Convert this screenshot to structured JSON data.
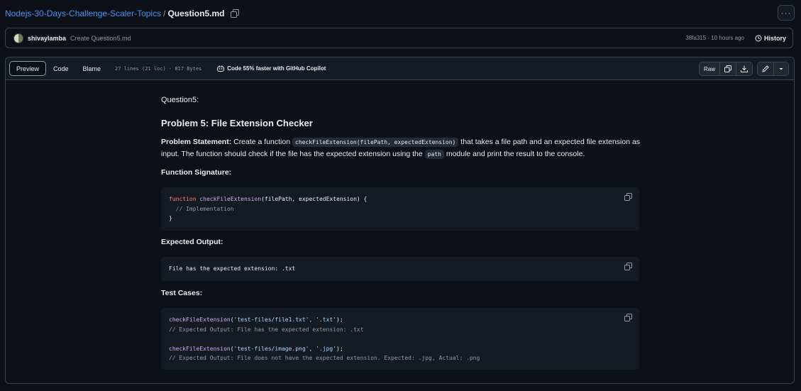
{
  "breadcrumb": {
    "repo": "Nodejs-30-Days-Challenge-Scaler-Topics",
    "sep": "/",
    "file": "Question5.md"
  },
  "commit": {
    "author": "shivaylamba",
    "message": "Create Question5.md",
    "meta": "38fa315 · 10 hours ago",
    "history_label": "History"
  },
  "filehead": {
    "tabs": [
      "Preview",
      "Code",
      "Blame"
    ],
    "info": "27 lines (21 loc) · 817 Bytes",
    "copilot": "Code 55% faster with GitHub Copilot",
    "raw_label": "Raw"
  },
  "markdown": {
    "question": "Question5:",
    "title": "Problem 5: File Extension Checker",
    "statement_label": "Problem Statement:",
    "statement_1": " Create a function ",
    "statement_code1": "checkFileExtension(filePath, expectedExtension)",
    "statement_2": " that takes a file path and an expected file extension as input. The function should check if the file has the expected extension using the ",
    "statement_code2": "path",
    "statement_3": " module and print the result to the console.",
    "signature_heading": "Function Signature:",
    "sig_kw": "function",
    "sig_fn": "checkFileExtension",
    "sig_rest": "(filePath, expectedExtension) {",
    "sig_comment": "  // Implementation",
    "sig_close": "}",
    "output_heading": "Expected Output:",
    "output_line": "File has the expected extension: .txt",
    "tests_heading": "Test Cases:",
    "t1_fn": "checkFileExtension",
    "t1_open": "(",
    "t1_args": "'test-files/file1.txt', '.txt'",
    "t1_close": ");",
    "t1_comment": "// Expected Output: File has the expected extension: .txt",
    "t2_fn": "checkFileExtension",
    "t2_open": "(",
    "t2_args": "'test-files/image.png', '.jpg'",
    "t2_close": ");",
    "t2_comment": "// Expected Output: File does not have the expected extension. Expected: .jpg, Actual: .png"
  }
}
